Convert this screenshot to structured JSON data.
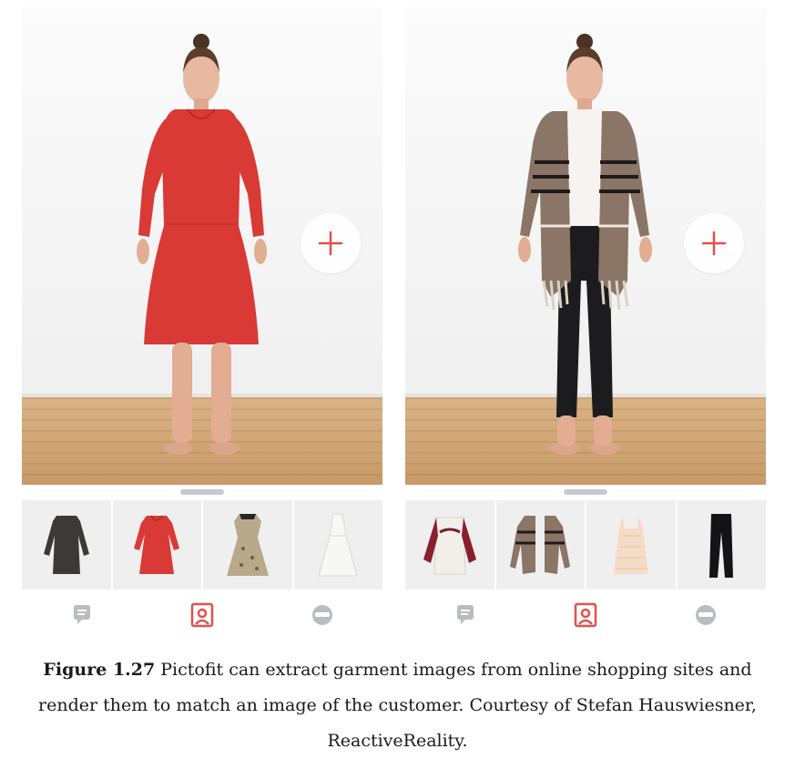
{
  "caption": {
    "label": "Figure 1.27",
    "text": "Pictofit can extract garment images from online shopping sites and render them to match an image of the customer. Courtesy of Stefan Hauswiesner, ReactiveReality."
  },
  "colors": {
    "accent": "#e0514f",
    "nav_inactive": "#b9bcc2",
    "handle": "#c7c9cd",
    "thumb_bg": "#efefef"
  },
  "panels": [
    {
      "outfit": "red-dress",
      "thumbnails": [
        "dark-knit-dress",
        "red-dress",
        "floral-dress",
        "white-halter-dress"
      ],
      "active_thumbnail": 1,
      "nav_icons": [
        "chat-icon",
        "wardrobe-icon",
        "avatar-icon"
      ],
      "active_nav": 1
    },
    {
      "outfit": "patterned-cardigan-black-jeans",
      "thumbnails": [
        "white-raglan-sweater",
        "patterned-cardigan",
        "striped-cami-top",
        "black-leggings"
      ],
      "active_thumbnail": 1,
      "nav_icons": [
        "chat-icon",
        "wardrobe-icon",
        "avatar-icon"
      ],
      "active_nav": 1
    }
  ]
}
